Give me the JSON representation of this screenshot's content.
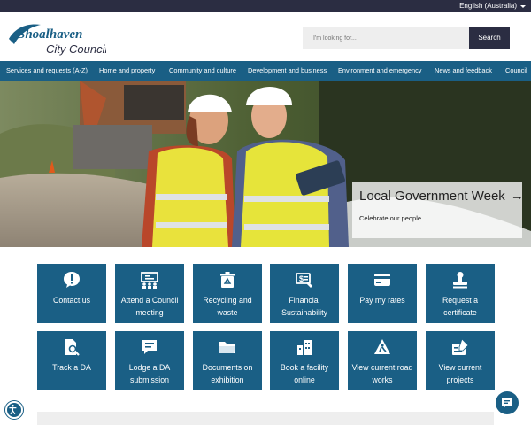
{
  "topbar": {
    "language": "English (Australia)"
  },
  "header": {
    "logo_line1": "Shoalhaven",
    "logo_line2": "City Council",
    "search_placeholder": "I'm looking for...",
    "search_button": "Search"
  },
  "nav": [
    "Services and requests (A-Z)",
    "Home and property",
    "Community and culture",
    "Development and business",
    "Environment and emergency",
    "News and feedback",
    "Council"
  ],
  "hero": {
    "title": "Local Government Week",
    "arrow": "→",
    "subtitle": "Celebrate our people"
  },
  "tiles": [
    {
      "label": "Contact us",
      "icon": "chat-alert-icon"
    },
    {
      "label": "Attend a Council meeting",
      "icon": "meeting-icon"
    },
    {
      "label": "Recycling and waste",
      "icon": "recycle-bin-icon"
    },
    {
      "label": "Financial Sustainability",
      "icon": "finance-icon"
    },
    {
      "label": "Pay my rates",
      "icon": "credit-card-icon"
    },
    {
      "label": "Request a certificate",
      "icon": "stamp-icon"
    },
    {
      "label": "Track a DA",
      "icon": "document-search-icon"
    },
    {
      "label": "Lodge a DA submission",
      "icon": "comment-icon"
    },
    {
      "label": "Documents on exhibition",
      "icon": "folder-icon"
    },
    {
      "label": "Book a facility online",
      "icon": "building-icon"
    },
    {
      "label": "View current road works",
      "icon": "road-works-icon"
    },
    {
      "label": "View current projects",
      "icon": "projects-icon"
    }
  ],
  "colors": {
    "brand": "#1a5f85",
    "dark": "#2b2d42"
  }
}
